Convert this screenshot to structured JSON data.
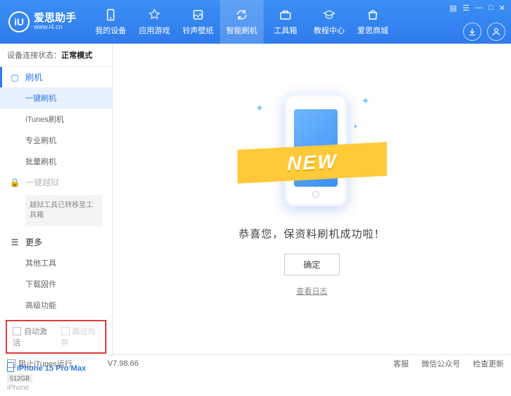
{
  "brand": {
    "name": "爱思助手",
    "url": "www.i4.cn",
    "logo_letter": "iU"
  },
  "win": {
    "list": "▤",
    "menu": "☰",
    "min": "—",
    "max": "□",
    "close": "✕"
  },
  "nav": [
    {
      "id": "device",
      "label": "我的设备"
    },
    {
      "id": "apps",
      "label": "应用游戏"
    },
    {
      "id": "ringtones",
      "label": "铃声壁纸"
    },
    {
      "id": "flash",
      "label": "智能刷机",
      "active": true
    },
    {
      "id": "toolbox",
      "label": "工具箱"
    },
    {
      "id": "tutorial",
      "label": "教程中心"
    },
    {
      "id": "mall",
      "label": "爱思商城"
    }
  ],
  "status": {
    "label": "设备连接状态：",
    "mode": "正常模式"
  },
  "sidebar": {
    "flash_header": "刷机",
    "items": [
      {
        "id": "oneclick",
        "label": "一键刷机",
        "active": true
      },
      {
        "id": "itunes",
        "label": "iTunes刷机"
      },
      {
        "id": "pro",
        "label": "专业刷机"
      },
      {
        "id": "batch",
        "label": "批量刷机"
      }
    ],
    "jailbreak_header": "一键越狱",
    "jailbreak_note": "越狱工具已转移至工具箱",
    "more_header": "更多",
    "more_items": [
      {
        "id": "othertools",
        "label": "其他工具"
      },
      {
        "id": "firmware",
        "label": "下载固件"
      },
      {
        "id": "advanced",
        "label": "高级功能"
      }
    ],
    "cb1": "自动激活",
    "cb2": "跳过向导"
  },
  "device": {
    "name": "iPhone 15 Pro Max",
    "storage": "512GB",
    "type": "iPhone"
  },
  "main": {
    "ribbon": "NEW",
    "success": "恭喜您，保资料刷机成功啦！",
    "ok": "确定",
    "view_log": "查看日志"
  },
  "footer": {
    "block_itunes": "阻止iTunes运行",
    "version": "V7.98.66",
    "support": "客服",
    "wechat": "微信公众号",
    "update": "检查更新"
  }
}
